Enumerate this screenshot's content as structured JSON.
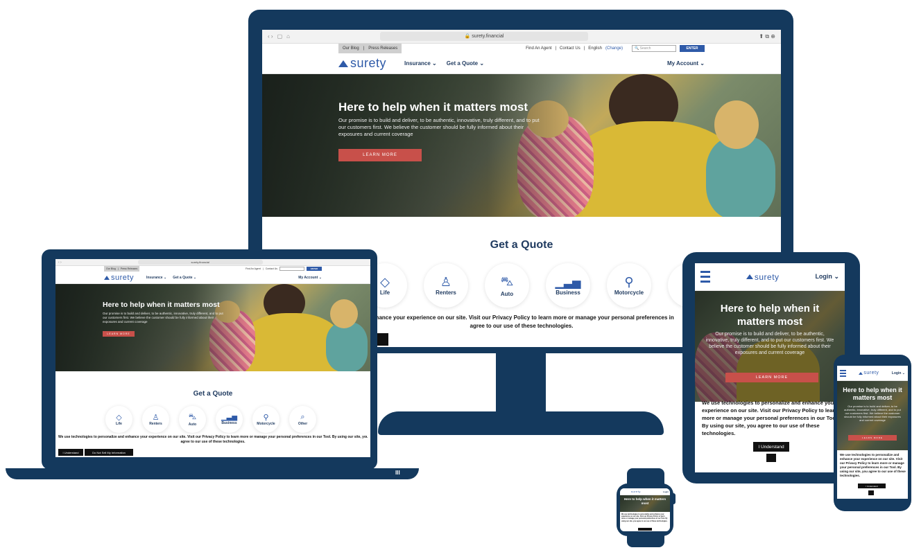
{
  "browser": {
    "url": "surety.financial",
    "search_placeholder": "Search",
    "enter_label": "ENTER"
  },
  "toplinks": {
    "blog": "Our Blog",
    "press": "Press Releases",
    "agent": "Find An Agent",
    "contact": "Contact Us",
    "language": "English",
    "change": "(Change)"
  },
  "brand": {
    "name": "surety"
  },
  "nav": {
    "insurance": "Insurance",
    "quote": "Get a Quote",
    "account": "My Account",
    "login": "Login"
  },
  "hero": {
    "title": "Here to help when it matters most",
    "body": "Our promise is to build and deliver, to be authentic, innovative, truly different, and to put our customers first. We believe the customer should be fully informed about their exposures and current coverage",
    "button": "LEARN MORE"
  },
  "quote": {
    "title": "Get a Quote",
    "items": [
      {
        "label": "Life",
        "icon": "diamond-icon"
      },
      {
        "label": "Renters",
        "icon": "person-icon"
      },
      {
        "label": "Auto",
        "icon": "car-icon"
      },
      {
        "label": "Business",
        "icon": "chart-icon"
      },
      {
        "label": "Motorcycle",
        "icon": "motorcycle-icon"
      },
      {
        "label": "Other",
        "icon": "search-icon"
      }
    ]
  },
  "cookie": {
    "desktop_line1": "enhance your experience on our site. Visit our Privacy Policy to learn more or manage your personal preferences in",
    "desktop_line2": "agree to our use of these technologies.",
    "laptop_line1": "We use technologies to personalize and enhance your experience on our site. Visit our Privacy Policy to learn more or manage your personal preferences in our Tool. By using our site, you",
    "laptop_line2": "agree to our use of these technologies.",
    "tablet_text": "We use technologies to personalize and enhance your experience on our site. Visit our Privacy Policy to learn more or manage your personal preferences in our Tool. By using our site, you agree to our use of these technologies.",
    "understand": "I Understand",
    "dnsmi": "Do Not Sell My Information"
  },
  "colors": {
    "device_frame": "#14395d",
    "brand_blue": "#2e5aa8",
    "cta_red": "#c8504a"
  }
}
